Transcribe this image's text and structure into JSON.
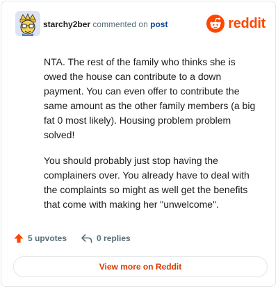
{
  "comment": {
    "username": "starchy2ber",
    "action_text": "commented on",
    "post_link": "post",
    "paragraphs": [
      "NTA. The rest of the family who thinks she is owed the house can contribute to a down payment. You can even offer to contribute the same amount as the other family members (a big fat 0 most likely). Housing problem problem solved!",
      "You should probably just stop having the complainers over. You already have to deal with the complaints so might as well get the benefits that come with making her \"unwelcome\"."
    ]
  },
  "brand": {
    "name": "reddit",
    "color": "#ff4500"
  },
  "actions": {
    "upvotes_label": "5 upvotes",
    "replies_label": "0 replies"
  },
  "footer": {
    "view_more_label": "View more on Reddit"
  },
  "icons": {
    "avatar": "avatar-icon",
    "brand": "reddit-logo-icon",
    "upvote": "upvote-arrow-icon",
    "reply": "reply-arrow-icon"
  },
  "colors": {
    "accent": "#ff4500",
    "link": "#0a449b",
    "muted": "#576f76",
    "text": "#1c1c1c"
  }
}
